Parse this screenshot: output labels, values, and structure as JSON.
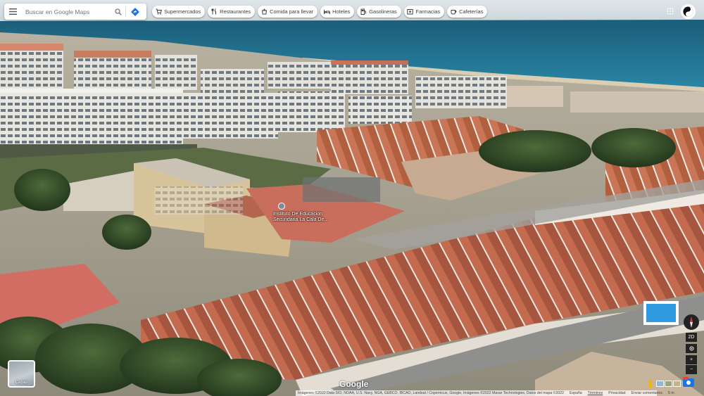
{
  "search": {
    "placeholder": "Buscar en Google Maps"
  },
  "icons": {
    "menu": "menu-icon",
    "search": "search-icon",
    "directions": "directions-icon",
    "apps": "apps-grid-icon",
    "account": "account-avatar-icon"
  },
  "chips": [
    {
      "label": "Supermercados",
      "icon": "cart-icon"
    },
    {
      "label": "Restaurantes",
      "icon": "cutlery-icon"
    },
    {
      "label": "Comida para llevar",
      "icon": "takeout-icon"
    },
    {
      "label": "Hoteles",
      "icon": "bed-icon"
    },
    {
      "label": "Gasolineras",
      "icon": "gas-pump-icon"
    },
    {
      "label": "Farmacias",
      "icon": "pharmacy-icon"
    },
    {
      "label": "Cafeterías",
      "icon": "coffee-icon"
    }
  ],
  "place": {
    "line1": "Instituto De Educacion",
    "line2": "Secundaria La Cala De..."
  },
  "logo": "Google",
  "layers": {
    "label": "Capas"
  },
  "controls": {
    "tilt": "2D",
    "zoom_in": "+",
    "zoom_out": "−"
  },
  "attribution": {
    "credits": "Imágenes ©2022 Data SIO, NOAA, U.S. Navy, NGA, GEBCO, IBCAO, Landsat / Copernicus, Google, Imágenes ©2022 Maxar Technologies, Datos del mapa ©2022",
    "country": "España",
    "terms": "Términos",
    "privacy": "Privacidad",
    "feedback": "Enviar comentarios",
    "scale": "5 m"
  },
  "colors": {
    "sea": "#1f6f8f",
    "accent": "#1a73e8",
    "roof": "#b8553f"
  }
}
